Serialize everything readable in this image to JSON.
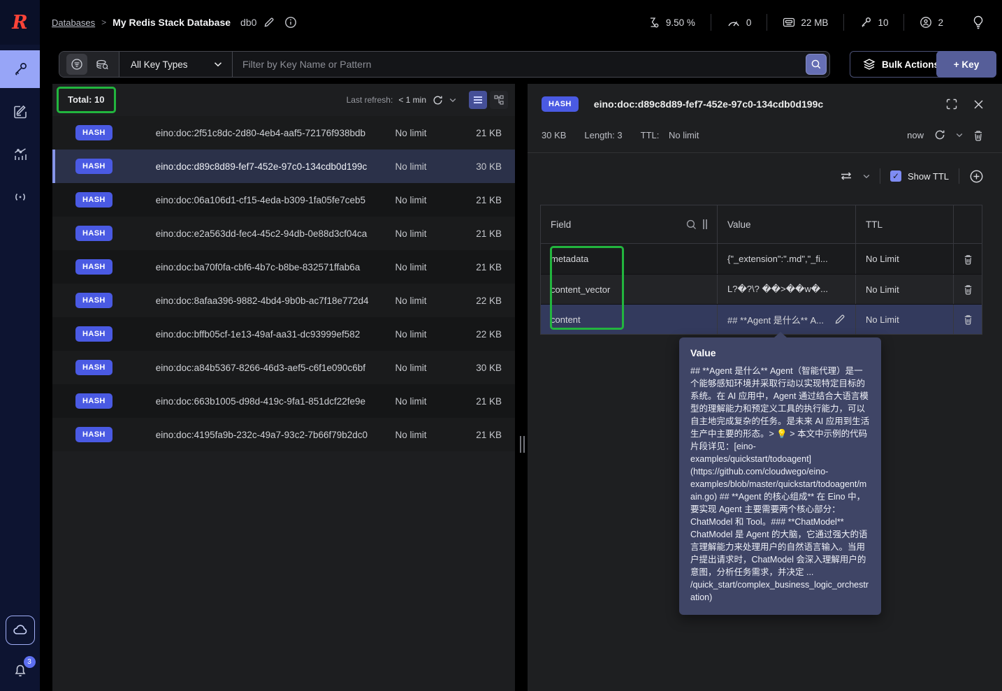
{
  "header": {
    "breadcrumb": {
      "link": "Databases",
      "separator": ">",
      "current": "My Redis Stack Database"
    },
    "db_index": "db0",
    "metrics": [
      {
        "icon": "cpu-icon",
        "value": "9.50 %"
      },
      {
        "icon": "commands-gauge-icon",
        "value": "0"
      },
      {
        "icon": "memory-icon",
        "value": "22 MB"
      },
      {
        "icon": "keys-icon",
        "value": "10"
      },
      {
        "icon": "clients-icon",
        "value": "2"
      }
    ]
  },
  "sidebar": {
    "notification_count": "3"
  },
  "filter": {
    "key_type_selector": "All Key Types",
    "input_placeholder": "Filter by Key Name or Pattern",
    "bulk_actions_label": "Bulk Actions",
    "add_key_label": "+ Key"
  },
  "key_list": {
    "total_label": "Total: 10",
    "last_refresh_label": "Last refresh:",
    "last_refresh_value": "< 1 min",
    "rows": [
      {
        "type": "HASH",
        "name": "eino:doc:2f51c8dc-2d80-4eb4-aaf5-72176f938bdb",
        "ttl": "No limit",
        "size": "21 KB"
      },
      {
        "type": "HASH",
        "name": "eino:doc:d89c8d89-fef7-452e-97c0-134cdb0d199c",
        "ttl": "No limit",
        "size": "30 KB"
      },
      {
        "type": "HASH",
        "name": "eino:doc:06a106d1-cf15-4eda-b309-1fa05fe7ceb5",
        "ttl": "No limit",
        "size": "21 KB"
      },
      {
        "type": "HASH",
        "name": "eino:doc:e2a563dd-fec4-45c2-94db-0e88d3cf04ca",
        "ttl": "No limit",
        "size": "21 KB"
      },
      {
        "type": "HASH",
        "name": "eino:doc:ba70f0fa-cbf6-4b7c-b8be-832571ffab6a",
        "ttl": "No limit",
        "size": "21 KB"
      },
      {
        "type": "HASH",
        "name": "eino:doc:8afaa396-9882-4bd4-9b0b-ac7f18e772d4",
        "ttl": "No limit",
        "size": "22 KB"
      },
      {
        "type": "HASH",
        "name": "eino:doc:bffb05cf-1e13-49af-aa31-dc93999ef582",
        "ttl": "No limit",
        "size": "22 KB"
      },
      {
        "type": "HASH",
        "name": "eino:doc:a84b5367-8266-46d3-aef5-c6f1e090c6bf",
        "ttl": "No limit",
        "size": "30 KB"
      },
      {
        "type": "HASH",
        "name": "eino:doc:663b1005-d98d-419c-9fa1-851dcf22fe9e",
        "ttl": "No limit",
        "size": "21 KB"
      },
      {
        "type": "HASH",
        "name": "eino:doc:4195fa9b-232c-49a7-93c2-7b66f79b2dc0",
        "ttl": "No limit",
        "size": "21 KB"
      }
    ]
  },
  "details": {
    "type_badge": "HASH",
    "key_name": "eino:doc:d89c8d89-fef7-452e-97c0-134cdb0d199c",
    "size": "30 KB",
    "length_label": "Length: 3",
    "ttl_label": "TTL:",
    "ttl_value": "No limit",
    "refreshed": "now",
    "show_ttl_label": "Show TTL",
    "table": {
      "headers": {
        "field": "Field",
        "value": "Value",
        "ttl": "TTL"
      },
      "rows": [
        {
          "field": "metadata",
          "value": "{\"_extension\":\".md\",\"_fi...",
          "ttl": "No Limit"
        },
        {
          "field": "content_vector",
          "value": "L?�?\\? ��>��w�...",
          "ttl": "No Limit"
        },
        {
          "field": "content",
          "value": "## **Agent 是什么** A...",
          "ttl": "No Limit"
        }
      ]
    }
  },
  "tooltip": {
    "title": "Value",
    "body": "## **Agent 是什么** Agent（智能代理）是一个能够感知环境并采取行动以实现特定目标的系统。在 AI 应用中，Agent 通过结合大语言模型的理解能力和预定义工具的执行能力，可以自主地完成复杂的任务。是未来 AI 应用到生活生产中主要的形态。> 💡 > 本文中示例的代码片段详见：[eino-examples/quickstart/todoagent](https://github.com/cloudwego/eino-examples/blob/master/quickstart/todoagent/main.go) ## **Agent 的核心组成** 在 Eino 中，要实现 Agent 主要需要两个核心部分：ChatModel 和 Tool。### **ChatModel** ChatModel 是 Agent 的大脑，它通过强大的语言理解能力来处理用户的自然语言输入。当用户提出请求时，ChatModel 会深入理解用户的意图，分析任务需求，并决定 ... /quick_start/complex_business_logic_orchestration)"
  },
  "colors": {
    "brand_red": "#ff4438",
    "badge_blue": "#4a5ae3",
    "annotation_green": "#22b53e",
    "accent_periwinkle": "#97a5f7",
    "selected_row": "#2b3149",
    "tooltip_bg": "#3f4566"
  },
  "icons": {
    "search-icon": "magnifier",
    "refresh-icon": "circular-arrow",
    "trash-icon": "trash-can",
    "edit-icon": "pencil",
    "lightbulb-icon": "bulb",
    "show-ttl-checkbox": "checked"
  }
}
